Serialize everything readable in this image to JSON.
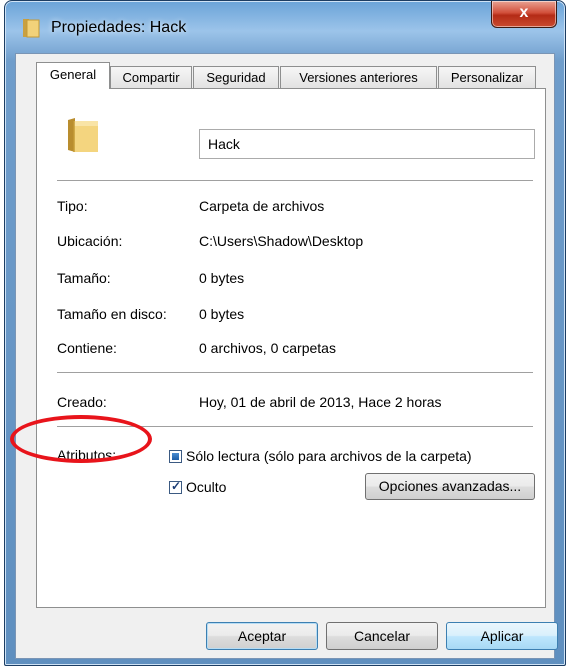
{
  "window": {
    "title": "Propiedades: Hack",
    "close_label": "x"
  },
  "tabs": [
    {
      "label": "General",
      "active": true
    },
    {
      "label": "Compartir",
      "active": false
    },
    {
      "label": "Seguridad",
      "active": false
    },
    {
      "label": "Versiones anteriores",
      "active": false
    },
    {
      "label": "Personalizar",
      "active": false
    }
  ],
  "folder": {
    "icon": "folder-icon",
    "name": "Hack"
  },
  "properties": {
    "tipo_label": "Tipo:",
    "tipo_value": "Carpeta de archivos",
    "ubicacion_label": "Ubicación:",
    "ubicacion_value": "C:\\Users\\Shadow\\Desktop",
    "tamano_label": "Tamaño:",
    "tamano_value": "0 bytes",
    "tamano_disco_label": "Tamaño en disco:",
    "tamano_disco_value": "0 bytes",
    "contiene_label": "Contiene:",
    "contiene_value": "0 archivos, 0 carpetas",
    "creado_label": "Creado:",
    "creado_value": "Hoy, 01 de abril de 2013, Hace 2 horas"
  },
  "attributes": {
    "label": "Atributos:",
    "readonly_label": "Sólo lectura (sólo para archivos de la carpeta)",
    "readonly_state": "indeterminate",
    "hidden_label": "Oculto",
    "hidden_state": "checked",
    "advanced_button": "Opciones avanzadas..."
  },
  "buttons": {
    "accept": "Aceptar",
    "cancel": "Cancelar",
    "apply": "Aplicar"
  },
  "colors": {
    "annotation_ellipse": "#e8141b",
    "title_bar": "#9cc4ea",
    "close_button": "#c94a2f"
  }
}
